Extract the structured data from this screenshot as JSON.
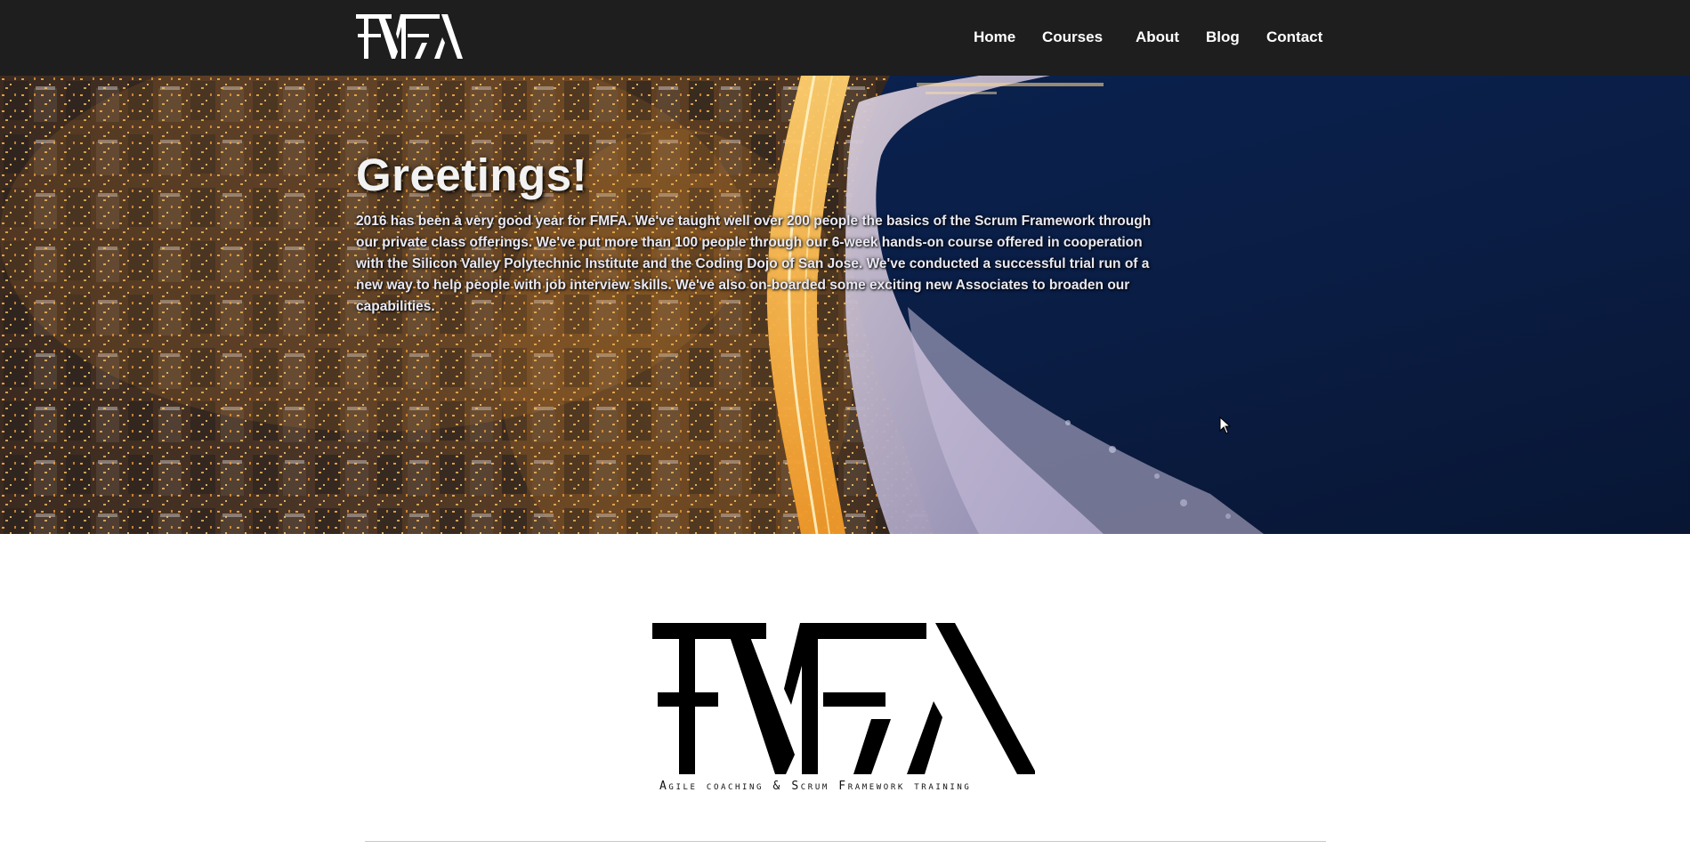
{
  "brand": {
    "logo_text": "FMFA",
    "tagline": "Agile coaching & Scrum Framework training"
  },
  "nav": {
    "items": [
      {
        "label": "Home"
      },
      {
        "label": "Courses"
      },
      {
        "label": "About"
      },
      {
        "label": "Blog"
      },
      {
        "label": "Contact"
      }
    ]
  },
  "hero": {
    "title": "Greetings!",
    "body": "2016 has been a very good year for FMFA. We've taught well over 200 people the basics of the Scrum Framework through our private class offerings. We've put more than 100 people through our 6-week hands-on course offered in cooperation with the Silicon Valley Polytechnic Institute and the Coding Dojo of San Jose. We've conducted a successful trial run of a new way to help people with job interview skills. We've also on-boarded some exciting new Associates to broaden our capabilities."
  },
  "colors": {
    "header_bg": "#1e1e1e",
    "nav_text": "#ffffff",
    "water": "#0c1f4a",
    "city_lights": "#f5a623",
    "divider": "#c9c9c9"
  },
  "icons": {
    "cursor": "mouse-pointer-icon"
  }
}
